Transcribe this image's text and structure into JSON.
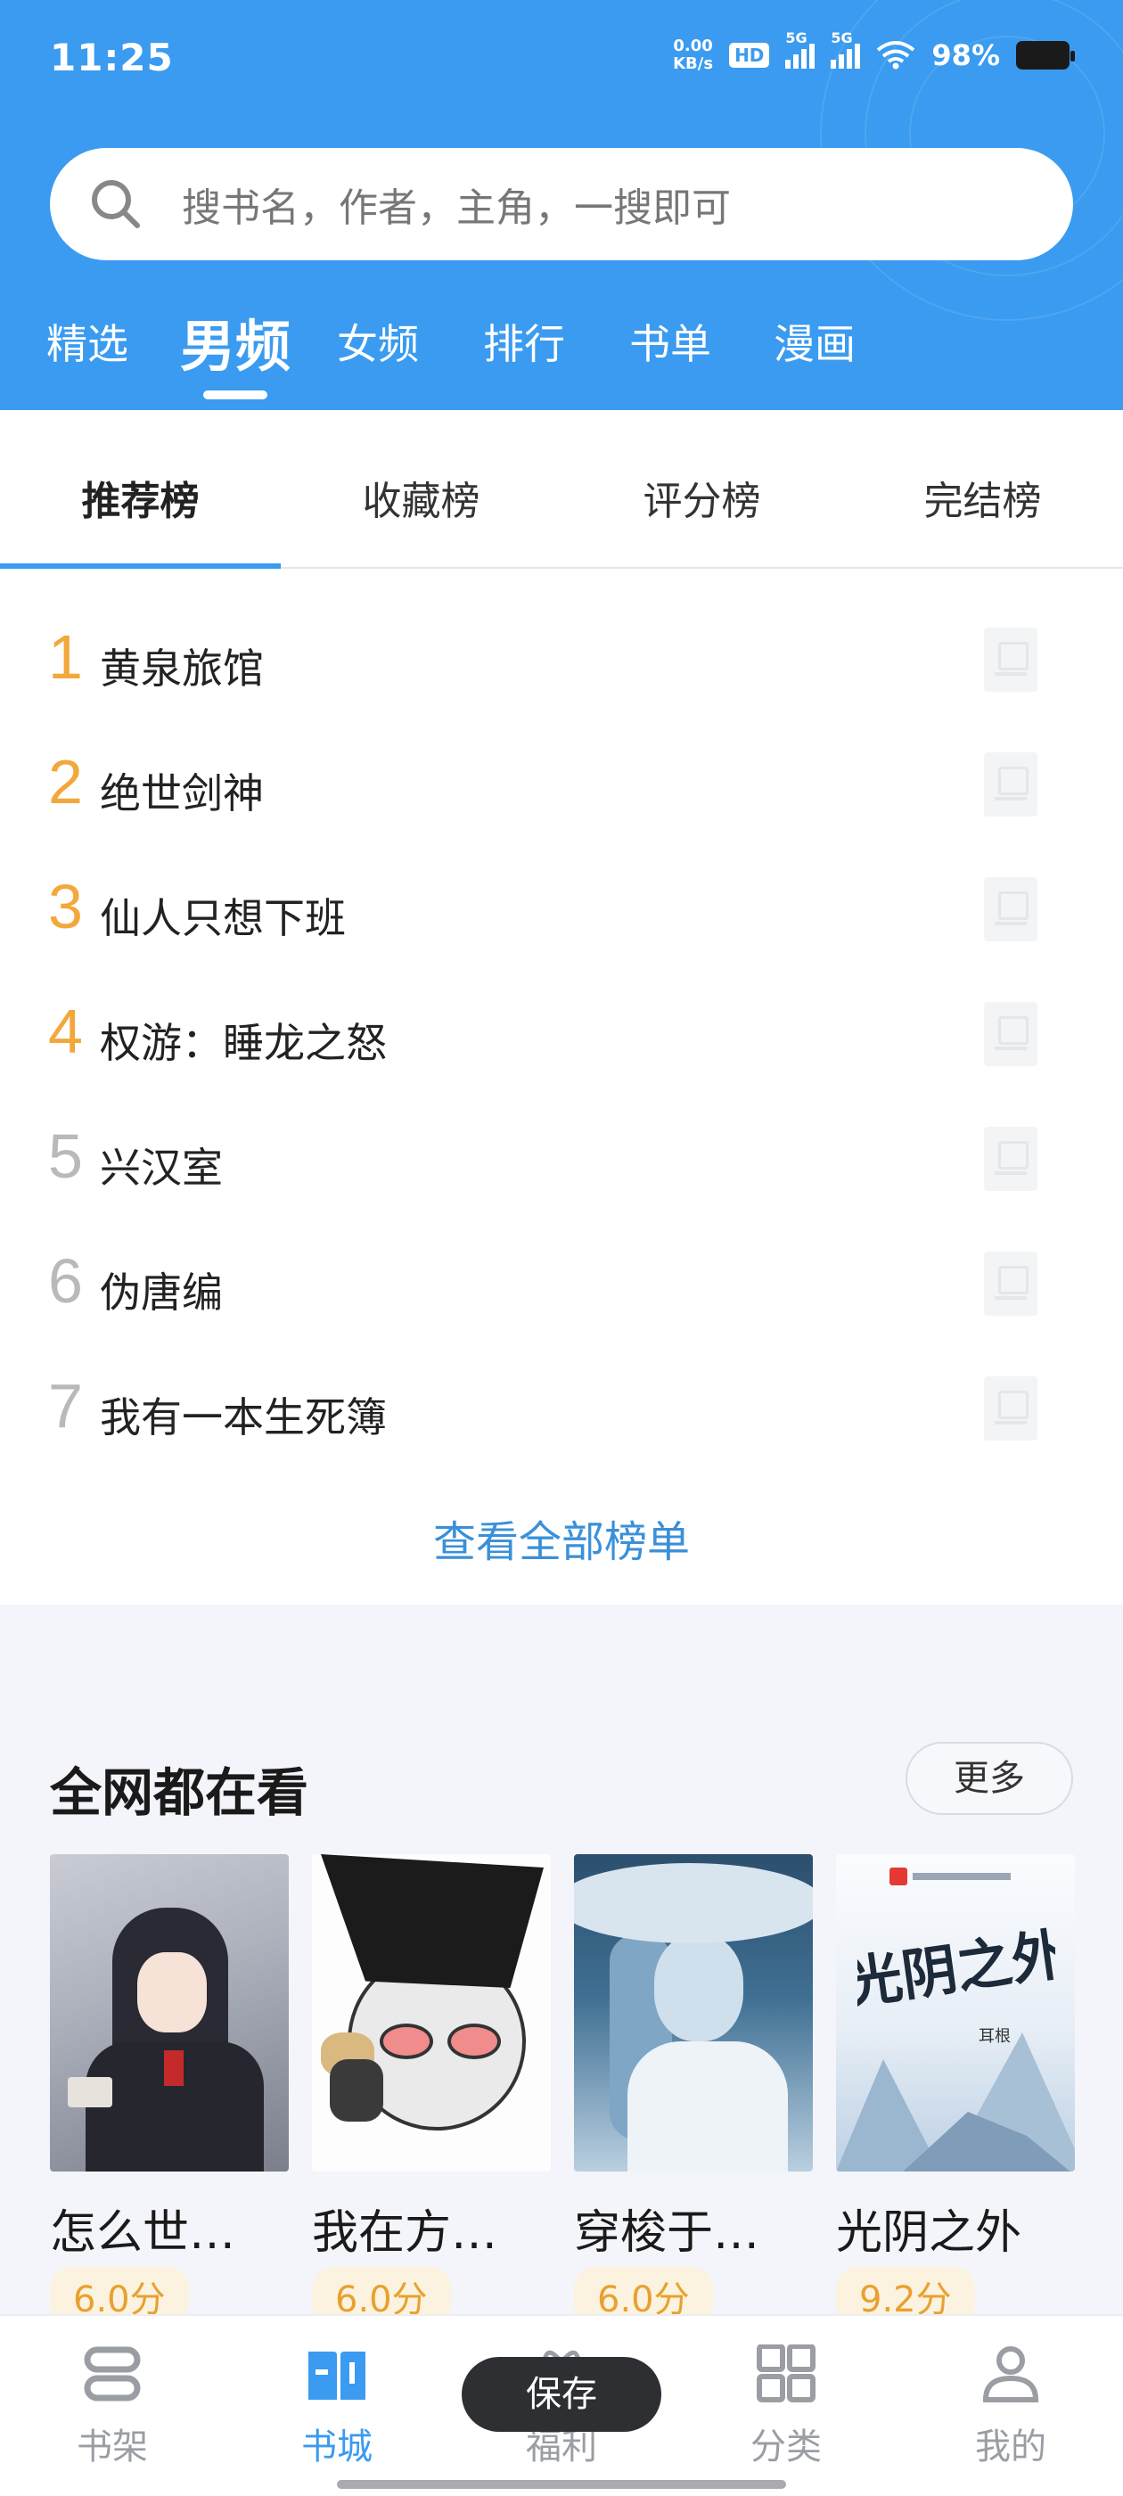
{
  "status_bar": {
    "time": "11:25",
    "net_speed_value": "0.00",
    "net_speed_unit": "KB/s",
    "hd_badge": "HD",
    "sim1_tag": "5G",
    "sim2_tag": "5G",
    "battery": "98%"
  },
  "search": {
    "placeholder": "搜书名，作者，主角，一搜即可"
  },
  "top_tabs": [
    {
      "label": "精选"
    },
    {
      "label": "男频",
      "active": true
    },
    {
      "label": "女频"
    },
    {
      "label": "排行"
    },
    {
      "label": "书单"
    },
    {
      "label": "漫画"
    }
  ],
  "rank_tabs": [
    {
      "label": "推荐榜",
      "active": true
    },
    {
      "label": "收藏榜"
    },
    {
      "label": "评分榜"
    },
    {
      "label": "完结榜"
    }
  ],
  "rank_list": [
    {
      "rank": "1",
      "title": "黄泉旅馆"
    },
    {
      "rank": "2",
      "title": "绝世剑神"
    },
    {
      "rank": "3",
      "title": "仙人只想下班"
    },
    {
      "rank": "4",
      "title": "权游：睡龙之怒"
    },
    {
      "rank": "5",
      "title": "兴汉室"
    },
    {
      "rank": "6",
      "title": "伪唐编"
    },
    {
      "rank": "7",
      "title": "我有一本生死簿"
    }
  ],
  "view_all": "查看全部榜单",
  "popular": {
    "title": "全网都在看",
    "more": "更多",
    "books": [
      {
        "title": "怎么世…",
        "score": "6.0分"
      },
      {
        "title": "我在方…",
        "score": "6.0分"
      },
      {
        "title": "穿梭于…",
        "score": "6.0分"
      },
      {
        "title": "光阴之外",
        "score": "9.2分",
        "cover_title": "光阴之外",
        "cover_author": "耳根"
      }
    ]
  },
  "toast": "保存",
  "bottom_nav": [
    {
      "label": "书架",
      "icon": "bookshelf-icon"
    },
    {
      "label": "书城",
      "icon": "bookstore-icon",
      "active": true
    },
    {
      "label": "福利",
      "icon": "gift-icon"
    },
    {
      "label": "分类",
      "icon": "category-grid-icon"
    },
    {
      "label": "我的",
      "icon": "profile-icon"
    }
  ],
  "colors": {
    "primary": "#3a9bf0",
    "rank_hot": "#f2a83a",
    "rank_cold": "#b9b9b9",
    "score": "#e8a130",
    "link": "#3a90d8"
  }
}
